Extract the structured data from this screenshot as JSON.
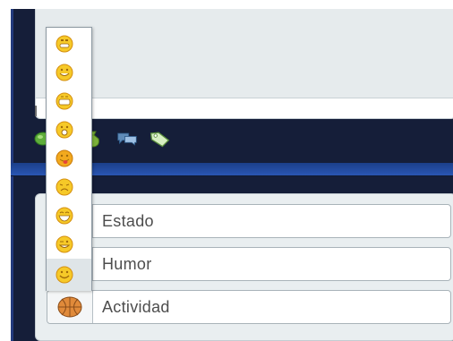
{
  "colors": {
    "app_background": "#151e39",
    "accent_blue": "#233a7d",
    "panel_background": "#e9eef0",
    "field_border": "#a9b3b9",
    "emoji_yellow": "#f6c928",
    "emoji_orange": "#e9a21e",
    "ball_orange": "#e08a3a"
  },
  "toolbar": {
    "icons": [
      "green-bubble-icon",
      "money-bag-icon",
      "chat-bubbles-icon",
      "price-tag-icon"
    ]
  },
  "emoji_picker": {
    "items": [
      "grin-icon",
      "smile-icon",
      "big-grin-icon",
      "surprised-icon",
      "tongue-icon",
      "sad-icon",
      "laugh-icon",
      "wink-icon",
      "happy-icon"
    ],
    "selected_index": 8
  },
  "form": {
    "fields": [
      {
        "label": "Estado",
        "icon": "smiley-icon"
      },
      {
        "label": "Humor",
        "icon": "happy-icon"
      },
      {
        "label": "Actividad",
        "icon": "basketball-icon"
      }
    ]
  }
}
